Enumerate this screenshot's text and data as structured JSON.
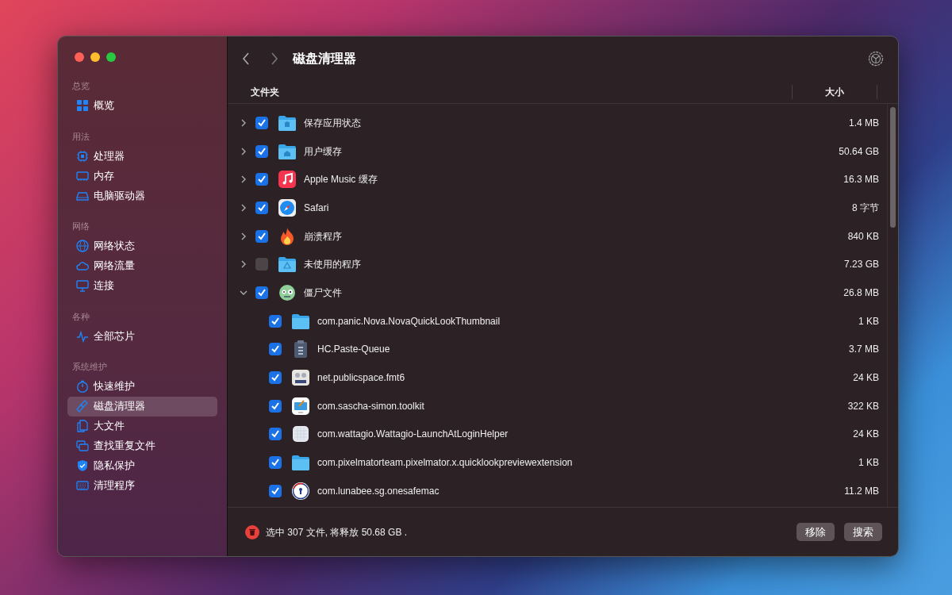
{
  "window": {
    "title": "磁盘清理器"
  },
  "sidebar": {
    "sections": [
      {
        "title": "总览",
        "items": [
          {
            "label": "概览",
            "selected": false
          }
        ]
      },
      {
        "title": "用法",
        "items": [
          {
            "label": "处理器",
            "selected": false
          },
          {
            "label": "内存",
            "selected": false
          },
          {
            "label": "电脑驱动器",
            "selected": false
          }
        ]
      },
      {
        "title": "网络",
        "items": [
          {
            "label": "网络状态",
            "selected": false
          },
          {
            "label": "网络流量",
            "selected": false
          },
          {
            "label": "连接",
            "selected": false
          }
        ]
      },
      {
        "title": "各种",
        "items": [
          {
            "label": "全部芯片",
            "selected": false
          }
        ]
      },
      {
        "title": "系统维护",
        "items": [
          {
            "label": "快速维护",
            "selected": false
          },
          {
            "label": "磁盘清理器",
            "selected": true
          },
          {
            "label": "大文件",
            "selected": false
          },
          {
            "label": "查找重复文件",
            "selected": false
          },
          {
            "label": "隐私保护",
            "selected": false
          },
          {
            "label": "清理程序",
            "selected": false
          }
        ]
      }
    ]
  },
  "table": {
    "columns": [
      "文件夹",
      "大小"
    ],
    "rows": [
      {
        "name": "保存应用状态",
        "size": "1.4 MB",
        "checked": true,
        "expanded": false
      },
      {
        "name": "用户缓存",
        "size": "50.64 GB",
        "checked": true,
        "expanded": false
      },
      {
        "name": "Apple Music 缓存",
        "size": "16.3 MB",
        "checked": true,
        "expanded": false
      },
      {
        "name": "Safari",
        "size": "8 字节",
        "checked": true,
        "expanded": false
      },
      {
        "name": "崩溃程序",
        "size": "840 KB",
        "checked": true,
        "expanded": false
      },
      {
        "name": "未使用的程序",
        "size": "7.23 GB",
        "checked": false,
        "expanded": false
      },
      {
        "name": "僵尸文件",
        "size": "26.8 MB",
        "checked": true,
        "expanded": true,
        "children": [
          {
            "name": "com.panic.Nova.NovaQuickLookThumbnail",
            "size": "1 KB",
            "checked": true
          },
          {
            "name": "HC.Paste-Queue",
            "size": "3.7 MB",
            "checked": true
          },
          {
            "name": "net.publicspace.fmt6",
            "size": "24 KB",
            "checked": true
          },
          {
            "name": "com.sascha-simon.toolkit",
            "size": "322 KB",
            "checked": true
          },
          {
            "name": "com.wattagio.Wattagio-LaunchAtLoginHelper",
            "size": "24 KB",
            "checked": true
          },
          {
            "name": "com.pixelmatorteam.pixelmator.x.quicklookpreviewextension",
            "size": "1 KB",
            "checked": true
          },
          {
            "name": "com.lunabee.sg.onesafemac",
            "size": "11.2 MB",
            "checked": true
          }
        ]
      }
    ]
  },
  "status_bar": {
    "text": "选中 307 文件, 将释放 50.68 GB .",
    "buttons": [
      "移除",
      "搜索"
    ]
  }
}
